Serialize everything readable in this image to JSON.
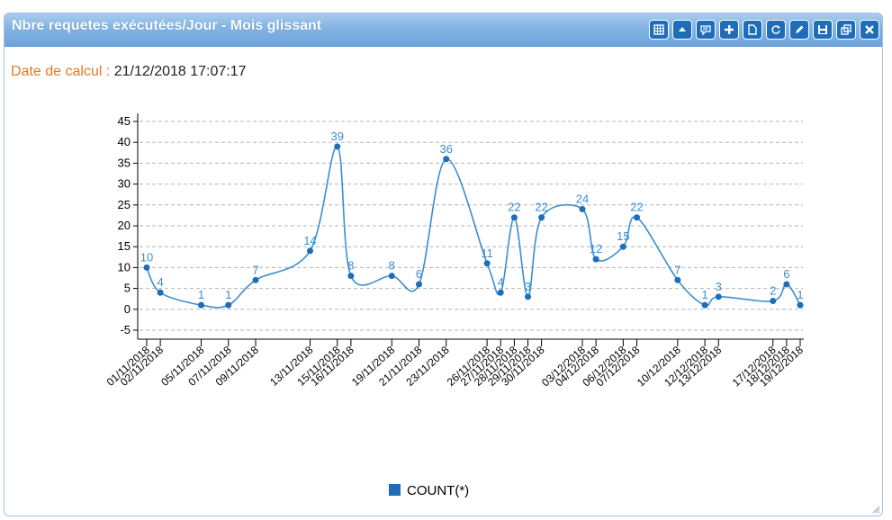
{
  "panel": {
    "title": "Nbre requetes exécutées/Jour - Mois glissant",
    "calc_label": "Date de calcul : ",
    "calc_value": "21/12/2018 17:07:17",
    "toolbar": [
      {
        "name": "grid-icon",
        "glyph": "grid"
      },
      {
        "name": "collapse-icon",
        "glyph": "up"
      },
      {
        "name": "comment-icon",
        "glyph": "comment"
      },
      {
        "name": "add-icon",
        "glyph": "plus"
      },
      {
        "name": "document-icon",
        "glyph": "doc"
      },
      {
        "name": "refresh-icon",
        "glyph": "refresh"
      },
      {
        "name": "edit-icon",
        "glyph": "pencil"
      },
      {
        "name": "save-icon",
        "glyph": "save"
      },
      {
        "name": "popout-icon",
        "glyph": "popout"
      },
      {
        "name": "close-icon",
        "glyph": "close"
      }
    ]
  },
  "chart_data": {
    "type": "line",
    "title": "",
    "xlabel": "",
    "ylabel": "",
    "ylim": [
      -5,
      45
    ],
    "yticks": [
      -5,
      0,
      5,
      10,
      15,
      20,
      25,
      30,
      35,
      40,
      45
    ],
    "grid": true,
    "legend_position": "bottom",
    "color": "#3a8fd0",
    "x": [
      "01/11/2018",
      "02/11/2018",
      "05/11/2018",
      "07/11/2018",
      "09/11/2018",
      "13/11/2018",
      "15/11/2018",
      "16/11/2018",
      "19/11/2018",
      "21/11/2018",
      "23/11/2018",
      "26/11/2018",
      "27/11/2018",
      "28/11/2018",
      "29/11/2018",
      "30/11/2018",
      "03/12/2018",
      "04/12/2018",
      "06/12/2018",
      "07/12/2018",
      "10/12/2018",
      "12/12/2018",
      "13/12/2018",
      "17/12/2018",
      "18/12/2018",
      "19/12/2018"
    ],
    "series": [
      {
        "name": "COUNT(*)",
        "values": [
          10,
          4,
          1,
          1,
          7,
          14,
          39,
          8,
          8,
          6,
          36,
          11,
          4,
          22,
          3,
          22,
          24,
          12,
          15,
          22,
          7,
          1,
          3,
          2,
          6,
          1
        ]
      }
    ]
  }
}
